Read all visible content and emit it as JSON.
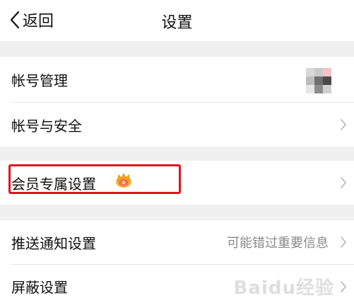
{
  "nav": {
    "back_label": "返回",
    "title": "设置"
  },
  "rows": {
    "account_management": "帐号管理",
    "account_security": "帐号与安全",
    "vip_settings": "会员专属设置",
    "push_settings": "推送通知设置",
    "push_value": "可能错过重要信息",
    "block_settings": "屏蔽设置"
  },
  "watermark": "Baidu经验",
  "colors": {
    "highlight": "#e0141e",
    "section_gap": "#f0f0f0",
    "secondary_text": "#8a8a8a"
  }
}
